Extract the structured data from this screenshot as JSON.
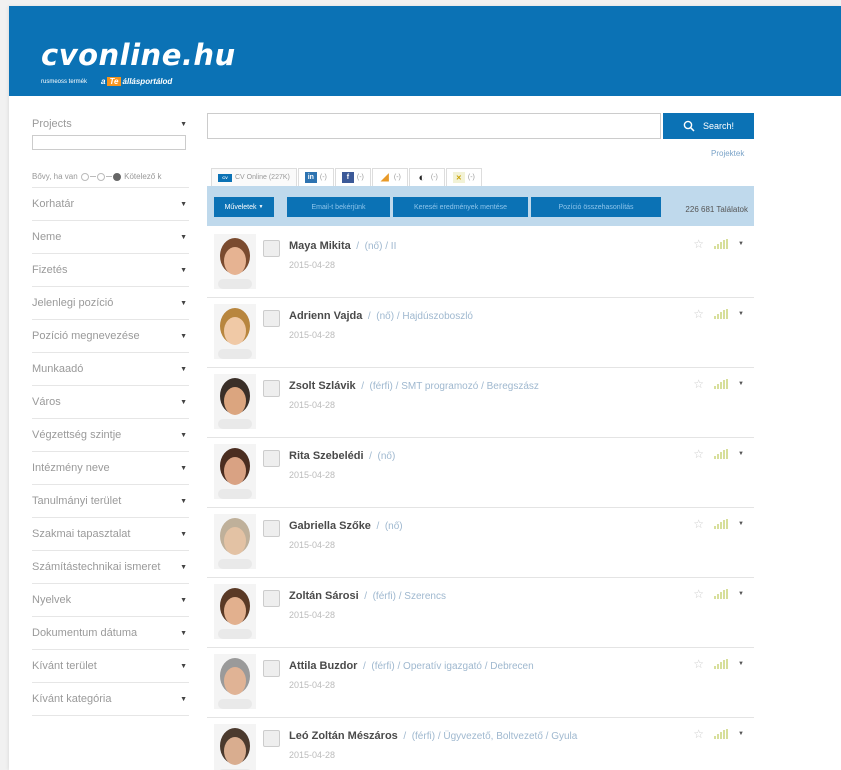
{
  "header": {
    "logo": "cvonline.hu",
    "brand_line": "rusmeoss termék",
    "slogan_prefix": "a",
    "slogan_te": "Te",
    "slogan_suffix": "állásportálod"
  },
  "sidebar": {
    "projects_label": "Projects",
    "toggle_left": "Bővy, ha van",
    "toggle_right": "Kötelező k",
    "filters": [
      "Korhatár",
      "Neme",
      "Fizetés",
      "Jelenlegi pozíció",
      "Pozíció megnevezése",
      "Munkaadó",
      "Város",
      "Végzettség szintje",
      "Intézmény neve",
      "Tanulmányi terület",
      "Szakmai tapasztalat",
      "Számítástechnikai ismeret",
      "Nyelvek",
      "Dokumentum dátuma",
      "Kívánt terület",
      "Kívánt kategória"
    ]
  },
  "search": {
    "button_label": "Search!",
    "placeholder": "",
    "projects_link": "Projektek"
  },
  "tabs": [
    {
      "icon": "cv-online-icon",
      "label": "CV Online (227K)"
    },
    {
      "icon": "linkedin-icon",
      "label": "(-)"
    },
    {
      "icon": "facebook-icon",
      "label": "(-)"
    },
    {
      "icon": "stats-icon",
      "label": "(-)"
    },
    {
      "icon": "github-icon",
      "label": "(-)"
    },
    {
      "icon": "xing-icon",
      "label": "(-)"
    }
  ],
  "actions": {
    "primary": "Műveletek",
    "btn2": "Email-t bekérjünk",
    "btn3": "Kereséi eredmények mentése",
    "btn4": "Pozíció összehasonlítás",
    "count": "226 681 Találatok"
  },
  "results": [
    {
      "name": "Maya Mikita",
      "gender": "(nő)",
      "extra": "/ II",
      "date": "2015-04-28"
    },
    {
      "name": "Adrienn Vajda",
      "gender": "(nő)",
      "extra": "/ Hajdúszoboszló",
      "date": "2015-04-28"
    },
    {
      "name": "Zsolt Szlávik",
      "gender": "(férfi)",
      "extra": "/ SMT programozó / Beregszász",
      "date": "2015-04-28"
    },
    {
      "name": "Rita Szebelédi",
      "gender": "(nő)",
      "extra": "",
      "date": "2015-04-28"
    },
    {
      "name": "Gabriella Szőke",
      "gender": "(nő)",
      "extra": "",
      "date": "2015-04-28"
    },
    {
      "name": "Zoltán Sárosi",
      "gender": "(férfi)",
      "extra": "/ Szerencs",
      "date": "2015-04-28"
    },
    {
      "name": "Attila Buzdor",
      "gender": "(férfi)",
      "extra": "/ Operatív igazgató / Debrecen",
      "date": "2015-04-28"
    },
    {
      "name": "Leó Zoltán Mészáros",
      "gender": "(férfi)",
      "extra": "/ Ügyvezető, Boltvezető / Gyula",
      "date": "2015-04-28"
    }
  ],
  "colors": {
    "brand": "#0b72b5",
    "accent": "#f7941d"
  }
}
